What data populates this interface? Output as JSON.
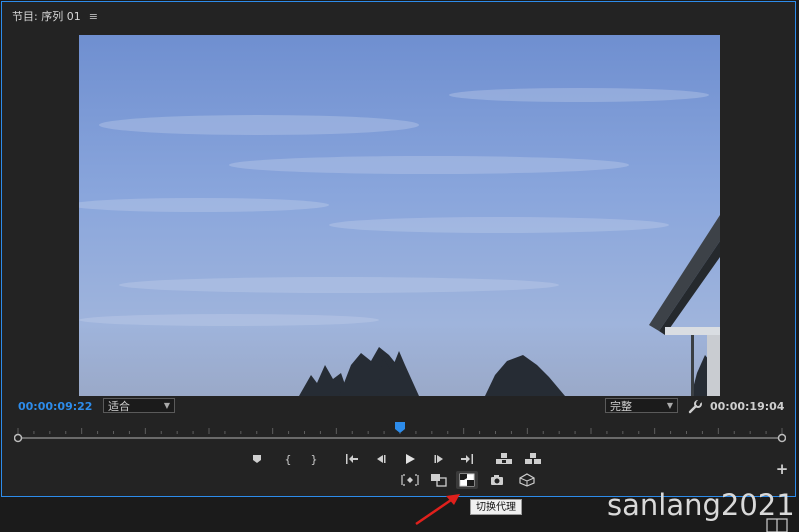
{
  "panel": {
    "title": "节目: 序列 01",
    "menu_glyph": "≡"
  },
  "timecode": {
    "current": "00:00:09:22",
    "duration": "00:00:19:04",
    "current_color": "#2d8ceb"
  },
  "zoom_select": {
    "value": "适合"
  },
  "resolution_select": {
    "value": "完整"
  },
  "playhead": {
    "position": 0.5
  },
  "transport": {
    "add_marker": "add-marker",
    "mark_in": "{",
    "mark_out": "}",
    "go_to_in": "go-to-in",
    "step_back": "step-back",
    "play": "play",
    "step_forward": "step-forward",
    "go_to_out": "go-to-out",
    "lift": "lift",
    "extract": "extract",
    "insert": "insert",
    "overwrite": "overwrite",
    "toggle_proxies": "toggle-proxies",
    "export_frame": "export-frame",
    "vr_video": "vr-video"
  },
  "tooltip": {
    "text": "切换代理"
  },
  "watermark": {
    "text": "sanlang2021"
  },
  "colors": {
    "accent": "#2d8ceb",
    "panel_bg": "#232323",
    "annotation_arrow": "#e0201c"
  }
}
